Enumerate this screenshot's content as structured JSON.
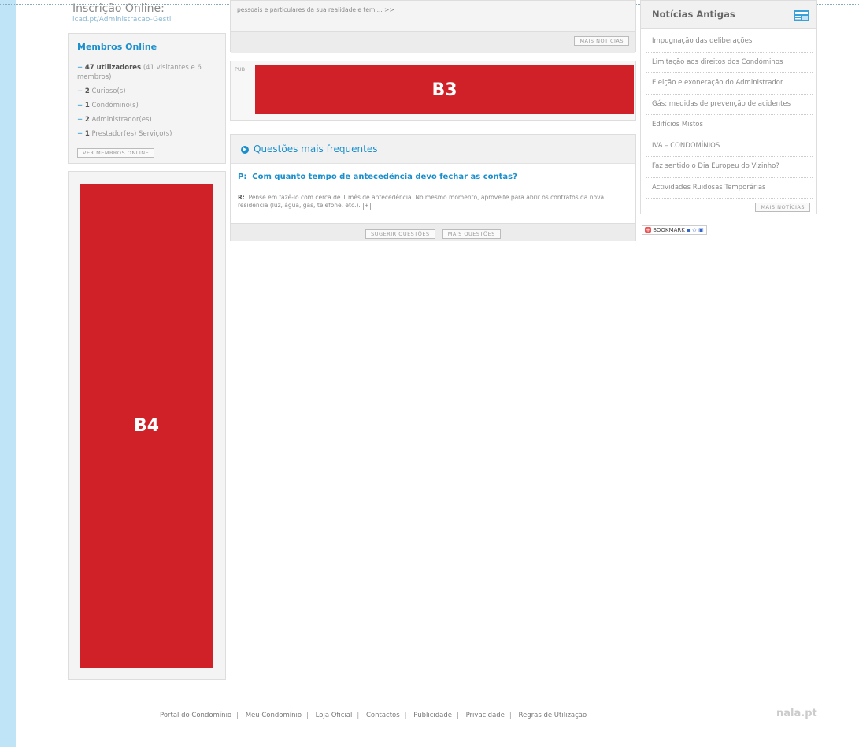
{
  "login": {
    "title": "Inscrição Online:",
    "url": "icad.pt/Administracao-Gesti"
  },
  "members": {
    "title": "Membros Online",
    "items": [
      {
        "count": "47",
        "label": " utilizadores",
        "extra": " (41 visitantes e 6 membros)"
      },
      {
        "count": "2",
        "label": " Curioso(s)",
        "extra": ""
      },
      {
        "count": "1",
        "label": " Condómino(s)",
        "extra": ""
      },
      {
        "count": "2",
        "label": " Administrador(es)",
        "extra": ""
      },
      {
        "count": "1",
        "label": " Prestador(es) Serviço(s)",
        "extra": ""
      }
    ],
    "button": "Ver membros online"
  },
  "ads": {
    "b3": "B3",
    "b4": "B4",
    "pub_label": "PUB"
  },
  "news_tail": {
    "text": "pessoais e particulares da sua realidade e tem ... >>",
    "button": "Mais notícias"
  },
  "faq": {
    "title": "Questões mais frequentes",
    "question_prefix": "P:",
    "question": "Com quanto tempo de antecedência devo fechar as contas?",
    "answer_prefix": "R:",
    "answer": "Pense em fazê-lo com cerca de 1 mês de antecedência. No mesmo momento, aproveite para abrir os contratos da nova residência (luz, água, gás, telefone, etc.).",
    "expand": "+",
    "buttons": {
      "suggest": "Sugerir questões",
      "more": "Mais questões"
    }
  },
  "old_news": {
    "title": "Notícias Antigas",
    "icon": "newspaper-icon",
    "items": [
      "Impugnação das deliberações",
      "Limitação aos direitos dos Condóminos",
      "Eleição e exoneração do Administrador",
      "Gás: medidas de prevenção de acidentes",
      "Edifícios Mistos",
      "IVA – CONDOMÍNIOS",
      "Faz sentido o Dia Europeu do Vizinho?",
      "Actividades Ruidosas Temporárias"
    ],
    "button": "Mais notícias"
  },
  "bookmark": {
    "label": "BOOKMARK",
    "icon": "plus-icon"
  },
  "footer": {
    "links": [
      "Portal do Condomínio",
      "Meu Condomínio",
      "Loja Oficial",
      "Contactos",
      "Publicidade",
      "Privacidade",
      "Regras de Utilização"
    ],
    "brand": "nala.pt"
  },
  "colors": {
    "accent": "#1a8fcc",
    "ad_red": "#d12128",
    "side_strip": "#bfe3f7"
  }
}
